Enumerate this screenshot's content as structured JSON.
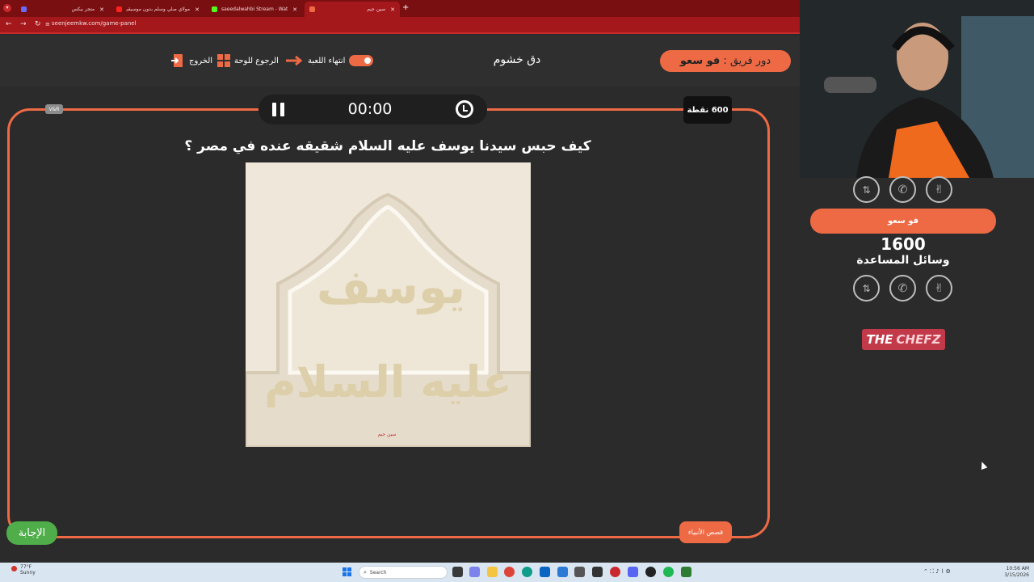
{
  "browser": {
    "tabs": [
      {
        "label": "متجر بيكس"
      },
      {
        "label": "مولاي صلي وسلم بدون موسيقى"
      },
      {
        "label": "saeedalwahbi Stream - Watch Li"
      },
      {
        "label": "سين جيم"
      }
    ],
    "url": "seenjeemkw.com/game-panel"
  },
  "header": {
    "team_prefix": "دور فريق :",
    "team_name": "فو سعو",
    "game_title": "دق خشوم",
    "end_game": "انتهاء اللعبة",
    "back_to_board": "الرجوع للوحة",
    "exit": "الخروج"
  },
  "board": {
    "timer": "00:00",
    "points": "600 نقطة",
    "vs_chip": "V&R",
    "question": "كيف حبس سيدنا يوسف عليه السلام شقيقه عنده في مصر ؟",
    "image_text_1": "يوسف",
    "image_text_2": "عليه السلام",
    "image_stamp": "سين جيم",
    "category": "قصص الأنبياء",
    "answer_button": "الإجابة"
  },
  "team_panel": {
    "team_name": "فو سعو",
    "score": "1600",
    "help_label": "وسائل المساعدة"
  },
  "logo": {
    "part1": "THE",
    "part2": "CHEFZ"
  },
  "taskbar": {
    "weather_temp": "77°F",
    "weather_desc": "Sunny",
    "search_placeholder": "Search",
    "time": "10:56 AM",
    "date": "3/15/2026"
  },
  "colors": {
    "accent": "#ee6a45",
    "answer": "#4fae4a",
    "browser": "#a4181c"
  }
}
